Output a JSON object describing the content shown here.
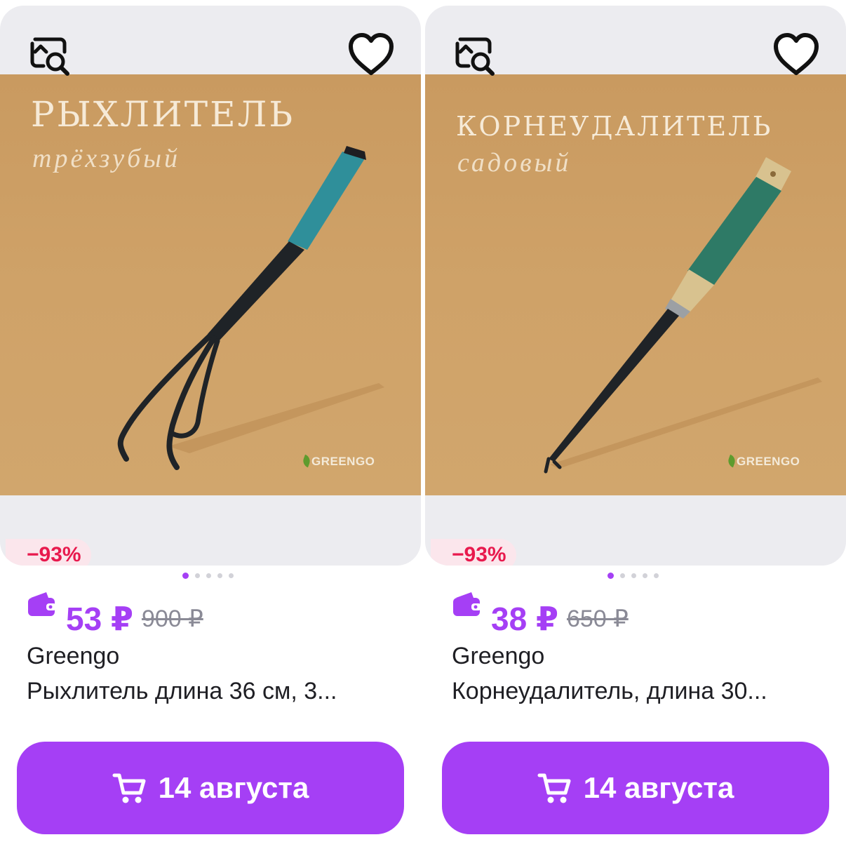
{
  "products": [
    {
      "photo_title": "РЫХЛИТЕЛЬ",
      "photo_subtitle": "трёхзубый",
      "photo_brand": "GREENGO",
      "discount": "−93%",
      "price": "53 ₽",
      "old_price": "900 ₽",
      "brand": "Greengo",
      "title": "Рыхлитель длина 36 см, 3...",
      "delivery": "14 августа",
      "photo_index": 1,
      "photo_count": 5
    },
    {
      "photo_title": "КОРНЕУДАЛИТЕЛЬ",
      "photo_subtitle": "садовый",
      "photo_brand": "GREENGO",
      "discount": "−93%",
      "price": "38 ₽",
      "old_price": "650 ₽",
      "brand": "Greengo",
      "title": "Корнеудалитель, длина 30...",
      "delivery": "14 августа",
      "photo_index": 1,
      "photo_count": 5
    }
  ],
  "icons": {
    "similar": "similar-search-icon",
    "favorite": "heart-icon",
    "wallet": "wallet-icon",
    "cart": "cart-icon"
  },
  "colors": {
    "accent": "#a53ff5",
    "discount_text": "#e8194d",
    "discount_bg": "#fbe6ec",
    "photo_bg": "#cfa268"
  }
}
